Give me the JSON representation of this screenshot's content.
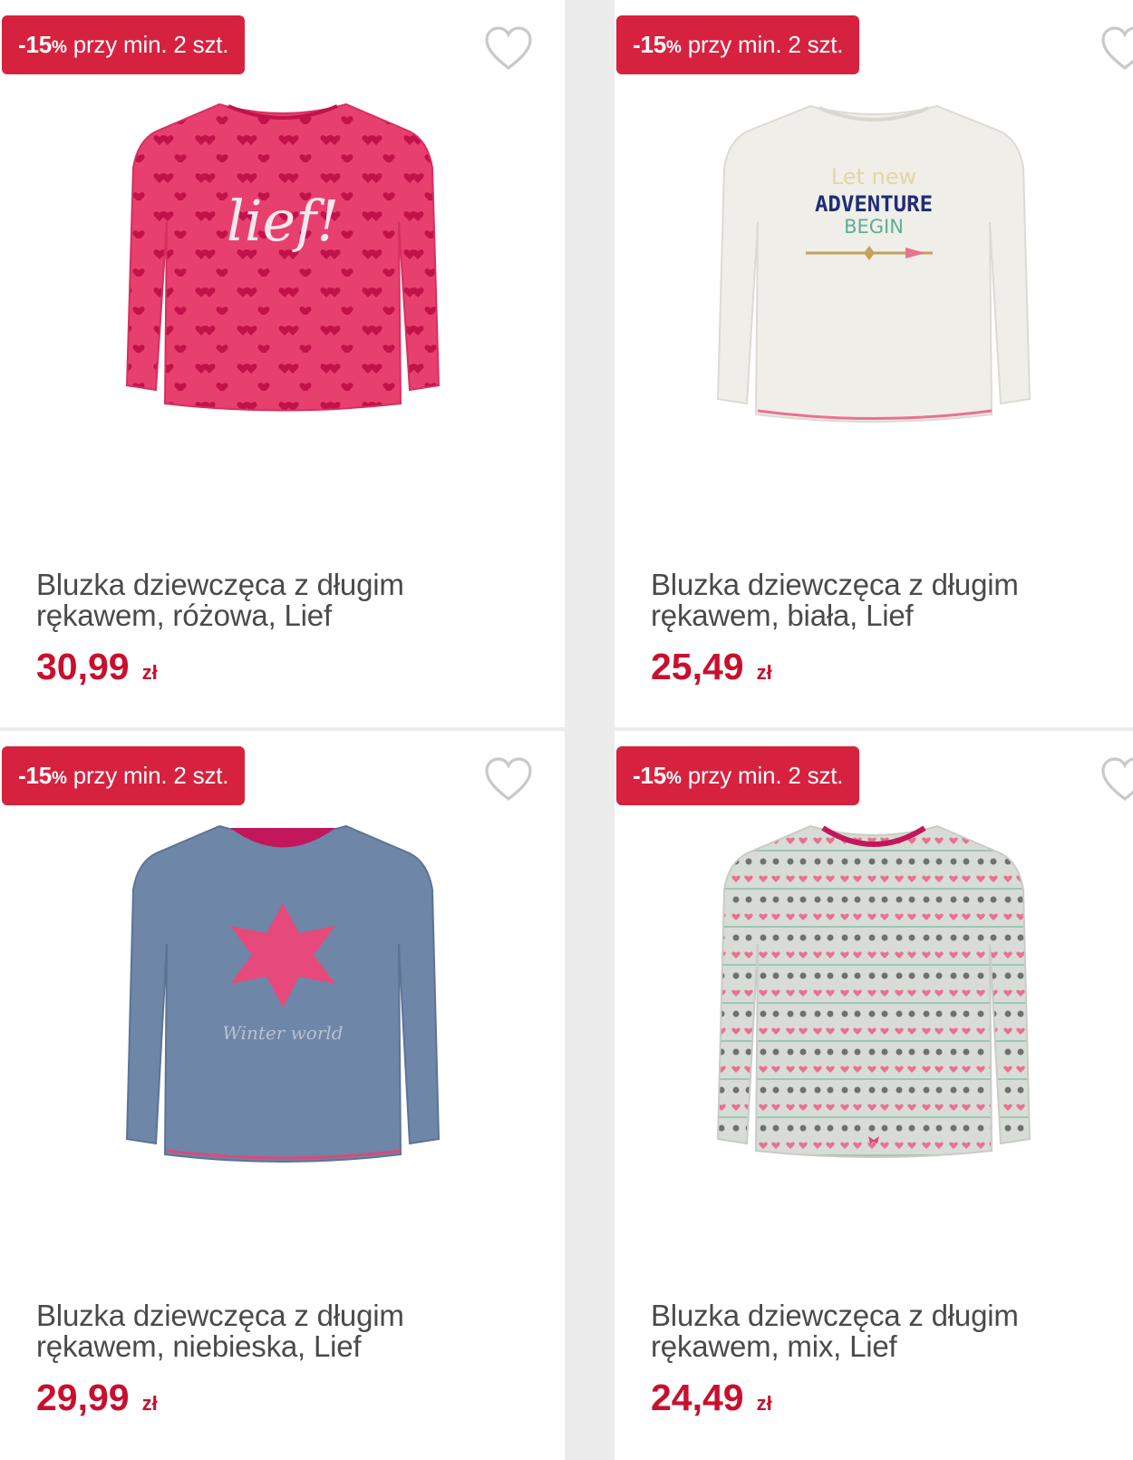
{
  "products": [
    {
      "badge_pct": "-15",
      "badge_pct_sign": "%",
      "badge_text": "przy min. 2 szt.",
      "title_line1": "Bluzka dziewczęca z długim",
      "title_line2": "rękawem, różowa, Lief",
      "price": "30,99",
      "currency": "zł",
      "shirt_color": "#e8406e",
      "icon": "heart-outline-icon"
    },
    {
      "badge_pct": "-15",
      "badge_pct_sign": "%",
      "badge_text": "przy min. 2 szt.",
      "title_line1": "Bluzka dziewczęca z długim",
      "title_line2": "rękawem, biała, Lief",
      "price": "25,49",
      "currency": "zł",
      "shirt_color": "#efeee9",
      "icon": "heart-outline-icon",
      "print_line1": "Let new",
      "print_line2": "ADVENTURE",
      "print_line3": "BEGIN"
    },
    {
      "badge_pct": "-15",
      "badge_pct_sign": "%",
      "badge_text": "przy min. 2 szt.",
      "title_line1": "Bluzka dziewczęca z długim",
      "title_line2": "rękawem, niebieska, Lief",
      "price": "29,99",
      "currency": "zł",
      "shirt_color": "#6e86a8",
      "icon": "heart-outline-icon",
      "print_line1": "Winter world"
    },
    {
      "badge_pct": "-15",
      "badge_pct_sign": "%",
      "badge_text": "przy min. 2 szt.",
      "title_line1": "Bluzka dziewczęca z długim",
      "title_line2": "rękawem, mix, Lief",
      "price": "24,49",
      "currency": "zł",
      "shirt_color": "#d8dcd6",
      "icon": "heart-outline-icon"
    }
  ],
  "colors": {
    "badge": "#d6223e",
    "price": "#c8102e",
    "title": "#4a4a4a",
    "heart": "#c9c9c9"
  }
}
